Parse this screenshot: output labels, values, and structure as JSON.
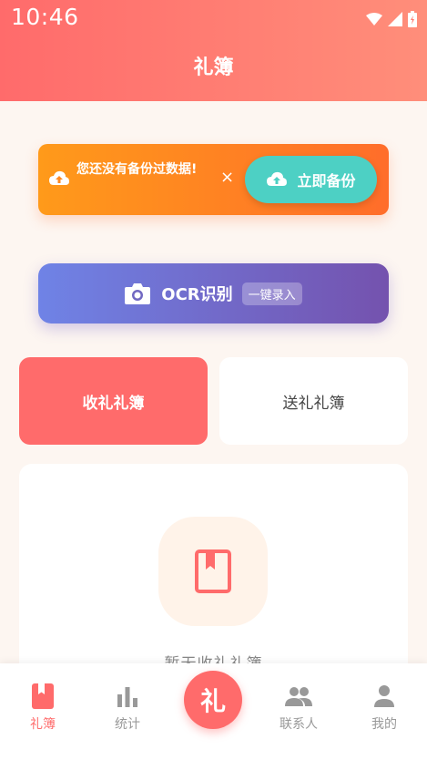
{
  "status_bar": {
    "time": "10:46"
  },
  "header": {
    "title": "礼簿"
  },
  "backup_banner": {
    "message": "您还没有备份过数据!",
    "close": "×",
    "button_label": "立即备份"
  },
  "ocr": {
    "label": "OCR识别",
    "badge": "一键录入"
  },
  "tabs": [
    {
      "label": "收礼礼簿"
    },
    {
      "label": "送礼礼簿"
    }
  ],
  "empty_state": {
    "text": "暂无收礼礼簿"
  },
  "bottom_nav": [
    {
      "label": "礼簿",
      "icon": "book-icon"
    },
    {
      "label": "统计",
      "icon": "bar-chart-icon"
    },
    {
      "label": "礼",
      "icon": "center-action"
    },
    {
      "label": "联系人",
      "icon": "people-icon"
    },
    {
      "label": "我的",
      "icon": "person-icon"
    }
  ],
  "colors": {
    "primary": "#ff6b6b",
    "teal": "#4dd0c4",
    "orange": "#ff9a1a",
    "purple": "#7452ae"
  }
}
